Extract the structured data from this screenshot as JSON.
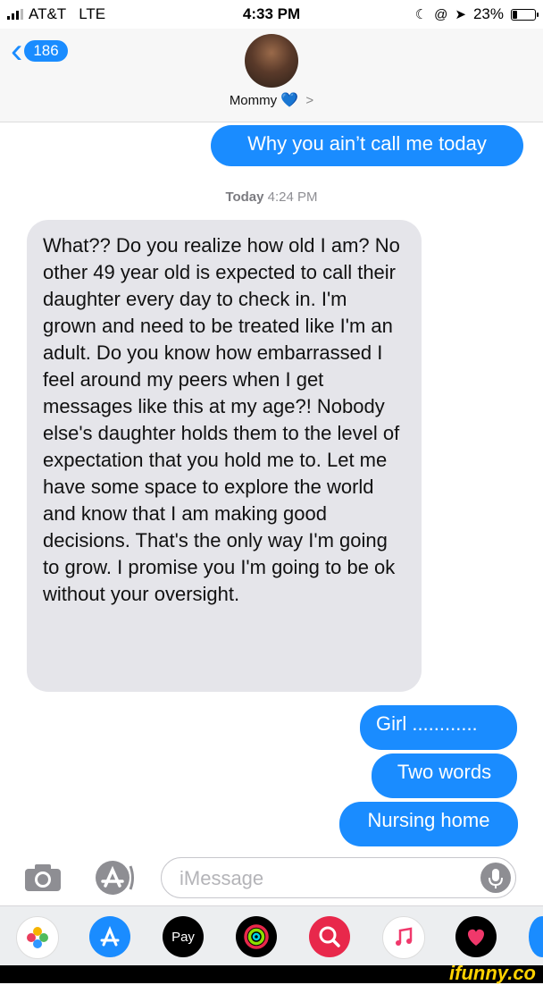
{
  "status_bar": {
    "carrier": "AT&T",
    "network": "LTE",
    "time": "4:33 PM",
    "battery": "23%",
    "battery_level": 0.23
  },
  "header": {
    "back_count": "186",
    "contact_name": "Mommy",
    "heart": "💙",
    "chevron": ">"
  },
  "messages": [
    {
      "from": "me",
      "text": "Why you ain’t call me today"
    },
    {
      "from": "them",
      "text": "What?? Do you realize how old I am? No other 49 year old is expected to call their daughter every day to check in. I'm grown and need to be treated like I'm an adult. Do you know how embarrassed I feel around my peers when I get messages like this at my age?! Nobody else's daughter holds them to the level of expectation that you hold me to.  Let me have some space to explore the world and know that I am making good decisions.  That's the only way I'm going to grow. I promise you I'm going to be ok without your oversight."
    },
    {
      "from": "me",
      "text": "Girl ............"
    },
    {
      "from": "me",
      "text": "Two words"
    },
    {
      "from": "me",
      "text": "Nursing home"
    }
  ],
  "timestamp": {
    "day": "Today",
    "time": "4:24 PM"
  },
  "composer": {
    "placeholder": "iMessage"
  },
  "app_tray": [
    {
      "icon": "photos-icon",
      "color": "#ffffff"
    },
    {
      "icon": "app-store-icon",
      "color": "#1a8cff"
    },
    {
      "icon": "apple-pay-icon",
      "color": "#000000",
      "label": "Pay"
    },
    {
      "icon": "activity-icon",
      "color": "#000000"
    },
    {
      "icon": "web-search-icon",
      "color": "#e8284b"
    },
    {
      "icon": "music-icon",
      "color": "#ffffff"
    },
    {
      "icon": "digital-touch-icon",
      "color": "#000000"
    }
  ],
  "watermark": "ifunny.co",
  "colors": {
    "blue_bubble": "#1a8cff",
    "grey_bubble": "#e5e5ea"
  }
}
